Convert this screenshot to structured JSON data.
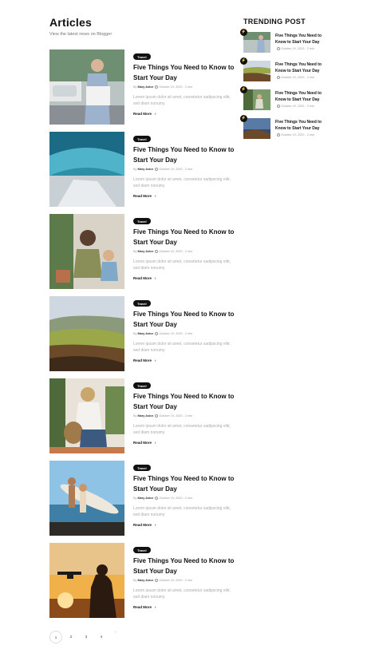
{
  "header": {
    "title": "Articles",
    "subtitle": "View the latest news on Blogger"
  },
  "articles": [
    {
      "badge": "Travel",
      "title": "Five Things You Need to Know to Start Your Day",
      "by": "By",
      "author": "Mary Astor",
      "date": "October 19, 2020",
      "read": "2 min",
      "excerpt": "Lorem ipsum dolor sit amet, consetetur sadipscing elitr, sed diam nonumy",
      "read_more": "Read More",
      "image": "woman-newspaper-street"
    },
    {
      "badge": "Travel",
      "title": "Five Things You Need to Know to Start Your Day",
      "by": "By",
      "author": "Mary Astor",
      "date": "October 19, 2020",
      "read": "2 min",
      "excerpt": "Lorem ipsum dolor sit amet, consetetur sadipscing elitr, sed diam nonumy",
      "read_more": "Read More",
      "image": "ice-cave"
    },
    {
      "badge": "Travel",
      "title": "Five Things You Need to Know to Start Your Day",
      "by": "By",
      "author": "Mary Astor",
      "date": "October 19, 2020",
      "read": "2 min",
      "excerpt": "Lorem ipsum dolor sit amet, consetetur sadipscing elitr, sed diam nonumy",
      "read_more": "Read More",
      "image": "mother-child-plants"
    },
    {
      "badge": "Travel",
      "title": "Five Things You Need to Know to Start Your Day",
      "by": "By",
      "author": "Mary Astor",
      "date": "October 19, 2020",
      "read": "2 min",
      "excerpt": "Lorem ipsum dolor sit amet, consetetur sadipscing elitr, sed diam nonumy",
      "read_more": "Read More",
      "image": "rolling-hills"
    },
    {
      "badge": "Travel",
      "title": "Five Things You Need to Know to Start Your Day",
      "by": "By",
      "author": "Mary Astor",
      "date": "October 19, 2020",
      "read": "2 min",
      "excerpt": "Lorem ipsum dolor sit amet, consetetur sadipscing elitr, sed diam nonumy",
      "read_more": "Read More",
      "image": "woman-straw-hat"
    },
    {
      "badge": "Travel",
      "title": "Five Things You Need to Know to Start Your Day",
      "by": "By",
      "author": "Mary Astor",
      "date": "October 19, 2020",
      "read": "2 min",
      "excerpt": "Lorem ipsum dolor sit amet, consetetur sadipscing elitr, sed diam nonumy",
      "read_more": "Read More",
      "image": "surfers-beach"
    },
    {
      "badge": "Travel",
      "title": "Five Things You Need to Know to Start Your Day",
      "by": "By",
      "author": "Mary Astor",
      "date": "October 19, 2020",
      "read": "2 min",
      "excerpt": "Lorem ipsum dolor sit amet, consetetur sadipscing elitr, sed diam nonumy",
      "read_more": "Read More",
      "image": "drone-sunset"
    }
  ],
  "sidebar": {
    "title": "TRENDING POST",
    "items": [
      {
        "title": "Five Things You Need to Know to Start Your Day",
        "date": "October 19, 2020",
        "read": "2 min"
      },
      {
        "title": "Five Things You Need to Know to Start Your Day",
        "date": "October 19, 2020",
        "read": "2 min"
      },
      {
        "title": "Five Things You Need to Know to Start Your Day",
        "date": "October 19, 2020",
        "read": "2 min"
      },
      {
        "title": "Five Things You Need to Know to Start Your Day",
        "date": "October 19, 2020",
        "read": "2 min"
      }
    ]
  },
  "pagination": {
    "pages": [
      "1",
      "2",
      "3",
      "4"
    ],
    "current": "1",
    "next": "›"
  },
  "icons": {
    "clock": "clock-icon",
    "arrow": "chevron-right-icon",
    "flash": "bolt-icon"
  }
}
